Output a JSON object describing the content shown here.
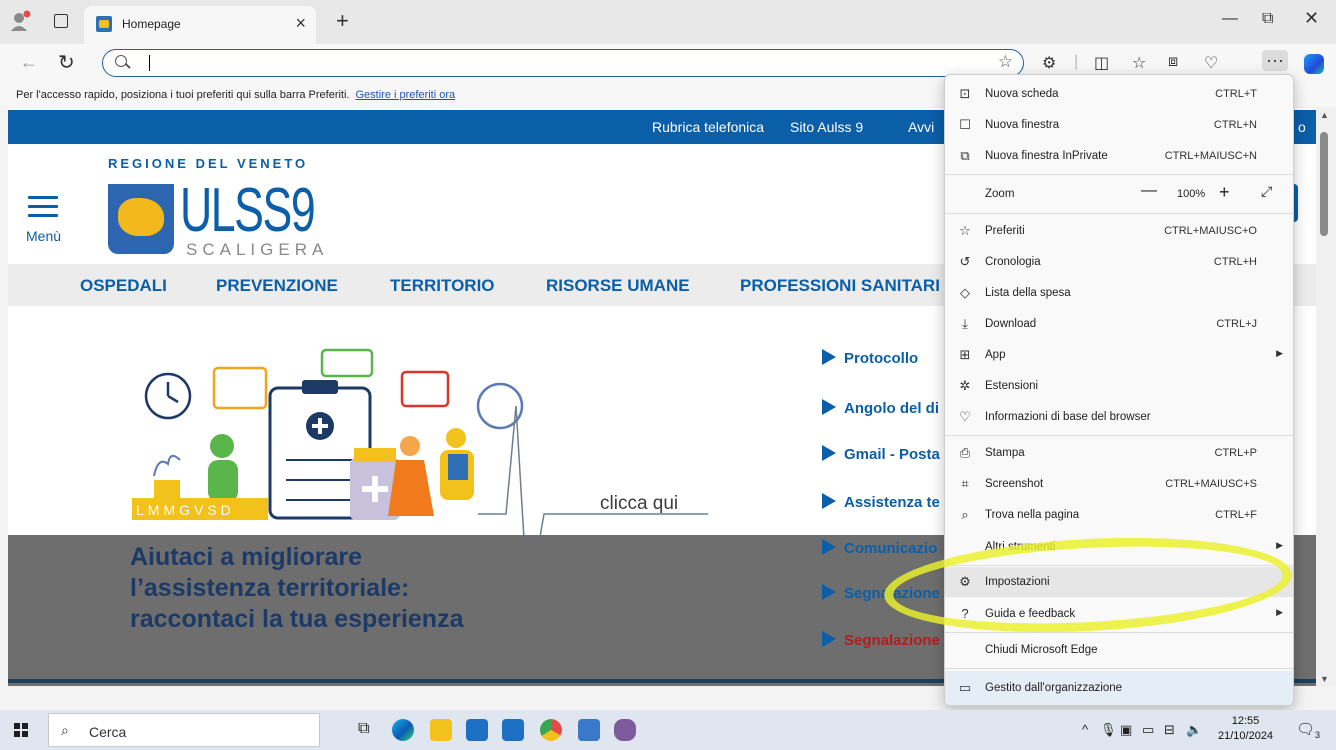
{
  "browser": {
    "tab_title": "Homepage",
    "address_value": "",
    "favbar_text": "Per l'accesso rapido, posiziona i tuoi preferiti qui sulla barra Preferiti.",
    "favbar_link": "Gestire i preferiti ora"
  },
  "page": {
    "top_links": [
      "Rubrica telefonica",
      "Sito Aulss 9",
      "Avvi",
      "o"
    ],
    "region_title": "REGIONE DEL VENETO",
    "logo_main": "ULSS9",
    "logo_sub": "SCALIGERA",
    "menu_label": "Menù",
    "main_nav": [
      "OSPEDALI",
      "PREVENZIONE",
      "TERRITORIO",
      "RISORSE UMANE",
      "PROFESSIONI SANITARI"
    ],
    "hero_letters": "LMMGVSD",
    "hero_cta": "clicca qui",
    "hero_line1": "Aiutaci a migliorare",
    "hero_line2": "l’assistenza territoriale:",
    "hero_line3": "raccontaci la tua esperienza",
    "side_links": [
      "Protocollo",
      "Angolo del di",
      "Gmail - Posta",
      "Assistenza te",
      "Comunicazio",
      "Segnalazione",
      "Segnalazione"
    ]
  },
  "menu": {
    "items": [
      {
        "label": "Nuova scheda",
        "shortcut": "CTRL+T",
        "icon": "new-tab-icon"
      },
      {
        "label": "Nuova finestra",
        "shortcut": "CTRL+N",
        "icon": "new-window-icon"
      },
      {
        "label": "Nuova finestra InPrivate",
        "shortcut": "CTRL+MAIUSC+N",
        "icon": "inprivate-icon"
      },
      {
        "label": "Zoom",
        "shortcut": "",
        "icon": ""
      },
      {
        "label": "Preferiti",
        "shortcut": "CTRL+MAIUSC+O",
        "icon": "favorites-icon"
      },
      {
        "label": "Cronologia",
        "shortcut": "CTRL+H",
        "icon": "history-icon"
      },
      {
        "label": "Lista della spesa",
        "shortcut": "",
        "icon": "shopping-tag-icon"
      },
      {
        "label": "Download",
        "shortcut": "CTRL+J",
        "icon": "download-icon"
      },
      {
        "label": "App",
        "shortcut": "",
        "icon": "apps-icon"
      },
      {
        "label": "Estensioni",
        "shortcut": "",
        "icon": "extensions-icon"
      },
      {
        "label": "Informazioni di base del browser",
        "shortcut": "",
        "icon": "browser-essentials-icon"
      },
      {
        "label": "Stampa",
        "shortcut": "CTRL+P",
        "icon": "print-icon"
      },
      {
        "label": "Screenshot",
        "shortcut": "CTRL+MAIUSC+S",
        "icon": "screenshot-icon"
      },
      {
        "label": "Trova nella pagina",
        "shortcut": "CTRL+F",
        "icon": "find-icon"
      },
      {
        "label": "Altri strumenti",
        "shortcut": "",
        "icon": ""
      },
      {
        "label": "Impostazioni",
        "shortcut": "",
        "icon": "settings-gear-icon"
      },
      {
        "label": "Guida e feedback",
        "shortcut": "",
        "icon": "help-icon"
      },
      {
        "label": "Chiudi Microsoft Edge",
        "shortcut": "",
        "icon": ""
      },
      {
        "label": "Gestito dall'organizzazione",
        "shortcut": "",
        "icon": "managed-briefcase-icon"
      }
    ],
    "zoom_value": "100%"
  },
  "taskbar": {
    "search_placeholder": "Cerca",
    "time": "12:55",
    "date": "21/10/2024",
    "notifications": "3"
  },
  "colors": {
    "brand_blue": "#0b5ea8",
    "highlight_yellow": "#ecf028"
  }
}
